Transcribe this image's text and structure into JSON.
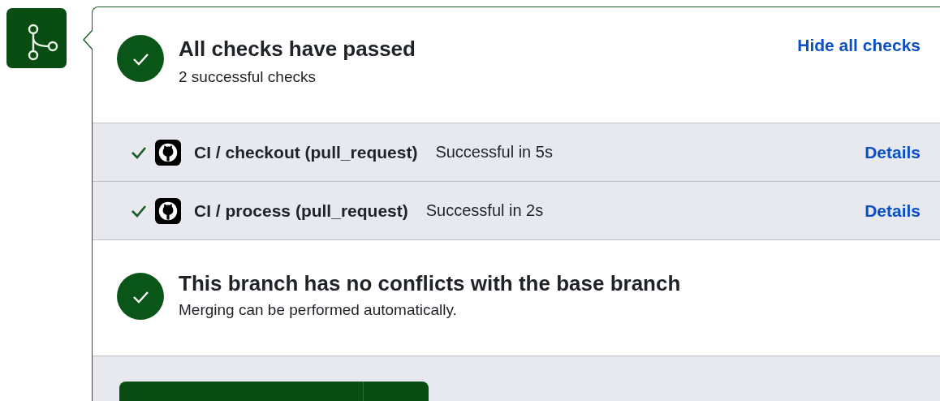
{
  "status": {
    "title": "All checks have passed",
    "subtitle": "2 successful checks",
    "toggle_link": "Hide all checks"
  },
  "checks": [
    {
      "name": "CI / checkout (pull_request)",
      "result": "Successful in 5s",
      "link": "Details",
      "passed": true
    },
    {
      "name": "CI / process (pull_request)",
      "result": "Successful in 2s",
      "link": "Details",
      "passed": true
    }
  ],
  "conflicts": {
    "title": "This branch has no conflicts with the base branch",
    "subtitle": "Merging can be performed automatically."
  }
}
